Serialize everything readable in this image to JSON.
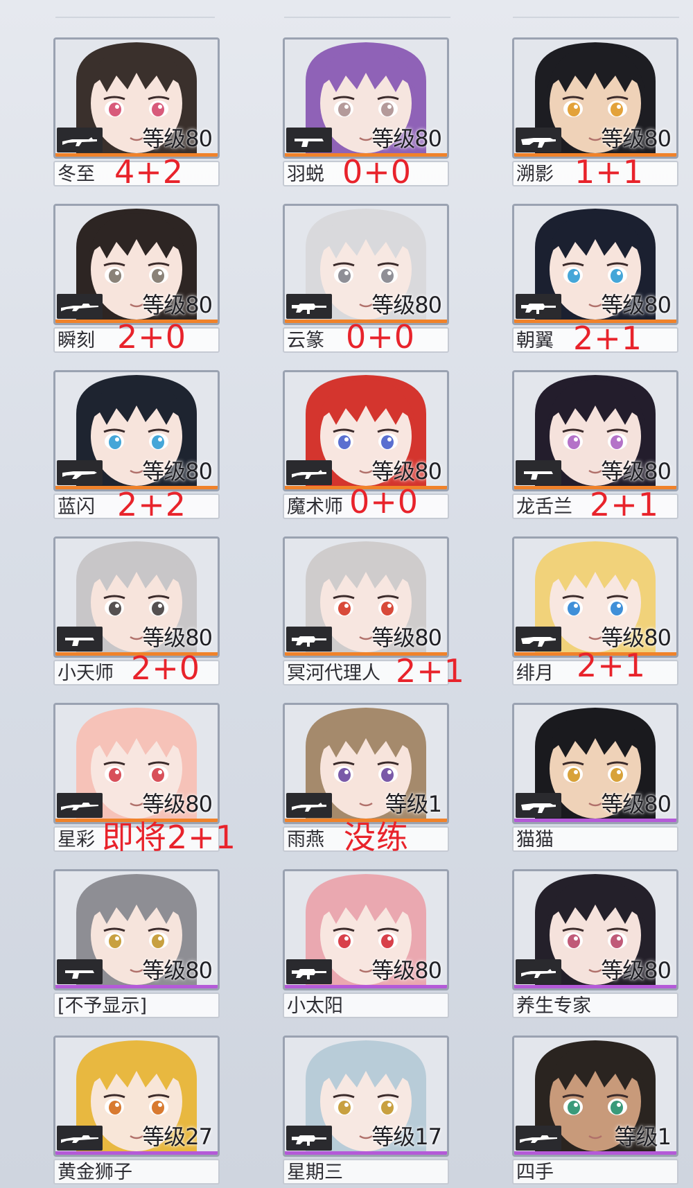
{
  "colors": {
    "rarity_orange": "#f0822a",
    "rarity_purple": "#b45ad8",
    "note_red": "#e8232b",
    "badge_bg": "#2a2a2e"
  },
  "cards": [
    {
      "name": "冬至",
      "level": "等级80",
      "note": "4+2",
      "rarity": "orange",
      "weapon": "rifle-icon",
      "hair": "#3a302c",
      "skin": "#f7e4dc",
      "eye": "#d85a7a"
    },
    {
      "name": "羽蜕",
      "level": "等级80",
      "note": "0+0",
      "rarity": "orange",
      "weapon": "pistol-icon",
      "hair": "#8f62b7",
      "skin": "#f6e5df",
      "eye": "#b49a9a"
    },
    {
      "name": "溯影",
      "level": "等级80",
      "note": "1+1",
      "rarity": "orange",
      "weapon": "smg-icon",
      "hair": "#1d1d22",
      "skin": "#efd2b8",
      "eye": "#e3a23a"
    },
    {
      "name": "瞬刻",
      "level": "等级80",
      "note": "2+0",
      "rarity": "orange",
      "weapon": "sniper-icon",
      "hair": "#2d2523",
      "skin": "#f7e4dc",
      "eye": "#8a8278"
    },
    {
      "name": "云篆",
      "level": "等级80",
      "note": "0+0",
      "rarity": "orange",
      "weapon": "assault-rifle-icon",
      "hair": "#d9d9dc",
      "skin": "#f7e8e2",
      "eye": "#8f8f96"
    },
    {
      "name": "朝翼",
      "level": "等级80",
      "note": "2+1",
      "rarity": "orange",
      "weapon": "assault-rifle-icon",
      "hair": "#1b2030",
      "skin": "#f7e4dc",
      "eye": "#45a6d8"
    },
    {
      "name": "蓝闪",
      "level": "等级80",
      "note": "2+2",
      "rarity": "orange",
      "weapon": "shotgun-icon",
      "hair": "#1e2430",
      "skin": "#f7e4dc",
      "eye": "#45a6d8"
    },
    {
      "name": "魔术师",
      "level": "等级80",
      "note": "0+0",
      "rarity": "orange",
      "weapon": "rifle-icon",
      "hair": "#d4352e",
      "skin": "#f8e6e0",
      "eye": "#5a6fd0"
    },
    {
      "name": "龙舌兰",
      "level": "等级80",
      "note": "2+1",
      "rarity": "orange",
      "weapon": "pistol-icon",
      "hair": "#231d2c",
      "skin": "#f5e2dc",
      "eye": "#b472c8"
    },
    {
      "name": "小天师",
      "level": "等级80",
      "note": "2+0",
      "rarity": "orange",
      "weapon": "pistol-icon",
      "hair": "#c8c6c8",
      "skin": "#f7e4dc",
      "eye": "#555050"
    },
    {
      "name": "冥河代理人",
      "level": "等级80",
      "note": "2+1",
      "rarity": "orange",
      "weapon": "assault-rifle-icon",
      "hair": "#cfcccc",
      "skin": "#f7e6e0",
      "eye": "#d84a3a"
    },
    {
      "name": "绯月",
      "level": "等级80",
      "note": "2+1",
      "rarity": "orange",
      "weapon": "smg-icon",
      "hair": "#f1d27a",
      "skin": "#f8e7e0",
      "eye": "#3f8fd8"
    },
    {
      "name": "星彩",
      "level": "等级80",
      "note": "即将2+1",
      "rarity": "orange",
      "weapon": "sniper-icon",
      "hair": "#f6c2b8",
      "skin": "#f8e6e0",
      "eye": "#d8505a"
    },
    {
      "name": "雨燕",
      "level": "等级1",
      "note": "没练",
      "rarity": "orange",
      "weapon": "rifle-icon",
      "hair": "#a58a6c",
      "skin": "#f7e4dc",
      "eye": "#7a5aa8"
    },
    {
      "name": "猫猫",
      "level": "等级80",
      "note": "",
      "rarity": "purple",
      "weapon": "smg-icon",
      "hair": "#1a1a1e",
      "skin": "#efd2b8",
      "eye": "#d8a23a"
    },
    {
      "name": "[不予显示]",
      "level": "等级80",
      "note": "",
      "rarity": "purple",
      "weapon": "pistol-icon",
      "hair": "#8e8e94",
      "skin": "#f6e4dc",
      "eye": "#c8a040"
    },
    {
      "name": "小太阳",
      "level": "等级80",
      "note": "",
      "rarity": "purple",
      "weapon": "assault-rifle-icon",
      "hair": "#eaa8b0",
      "skin": "#f8e6e0",
      "eye": "#d8404a"
    },
    {
      "name": "养生专家",
      "level": "等级80",
      "note": "",
      "rarity": "purple",
      "weapon": "rifle-icon",
      "hair": "#24202a",
      "skin": "#f5e2dc",
      "eye": "#c05a78"
    },
    {
      "name": "黄金狮子",
      "level": "等级27",
      "note": "",
      "rarity": "purple",
      "weapon": "sniper-icon",
      "hair": "#e8b840",
      "skin": "#f8e6d8",
      "eye": "#d87a30"
    },
    {
      "name": "星期三",
      "level": "等级17",
      "note": "",
      "rarity": "purple",
      "weapon": "assault-rifle-icon",
      "hair": "#b8ccd8",
      "skin": "#f7e8e2",
      "eye": "#c8a040"
    },
    {
      "name": "四手",
      "level": "等级1",
      "note": "",
      "rarity": "purple",
      "weapon": "sniper-icon",
      "hair": "#2a2420",
      "skin": "#c89a7a",
      "eye": "#3a9a7a"
    }
  ]
}
